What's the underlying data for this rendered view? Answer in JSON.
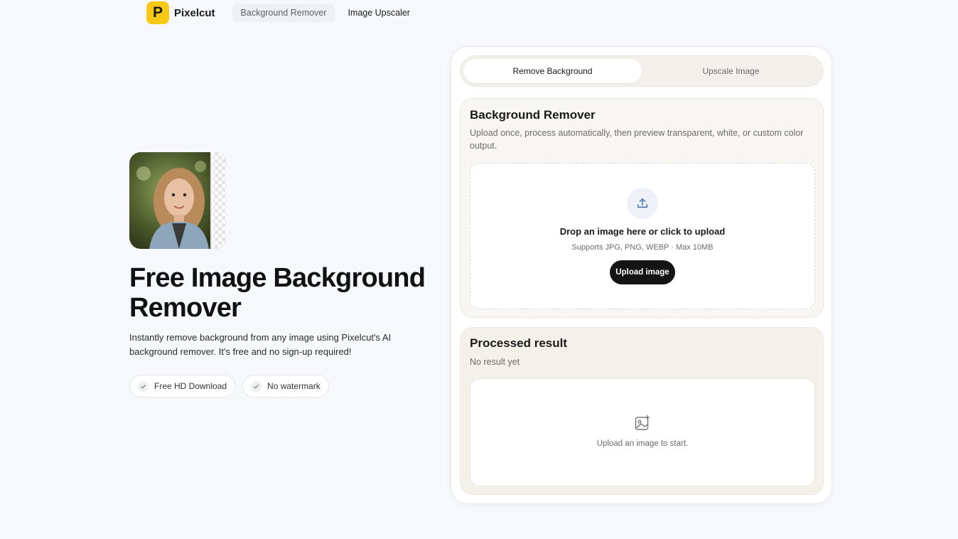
{
  "nav": {
    "logo_letter": "P",
    "brand": "Pixelcut",
    "links": [
      "Background Remover",
      "Image Upscaler"
    ]
  },
  "hero": {
    "title": "Free Image Background Remover",
    "subtitle": "Instantly remove background from any image using Pixelcut's AI background remover. It's free and no sign-up required!",
    "chips": [
      "Free HD Download",
      "No watermark"
    ]
  },
  "tabs": [
    "Remove Background",
    "Upscale Image"
  ],
  "remover": {
    "title": "Background Remover",
    "description": "Upload once, process automatically, then preview transparent, white, or custom color output.",
    "drop_title": "Drop an image here or click to upload",
    "drop_sub": "Supports JPG, PNG, WEBP · Max 10MB",
    "upload_label": "Upload image"
  },
  "result": {
    "title": "Processed result",
    "status": "No result yet",
    "empty_text": "Upload an image to start."
  },
  "colors": {
    "brand_yellow": "#f7c815",
    "button_dark": "#141414",
    "page_bg": "#f6f8fb"
  }
}
